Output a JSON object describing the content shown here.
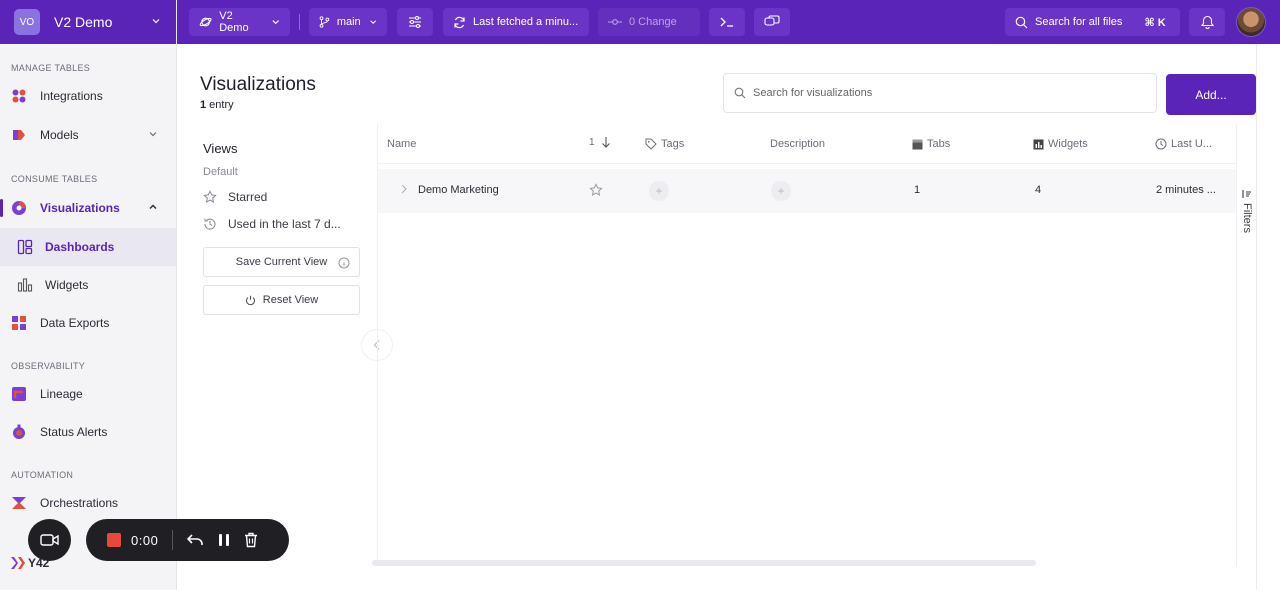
{
  "workspace": {
    "initials": "VO",
    "name": "V2 Demo"
  },
  "topbar": {
    "project": "V2 Demo",
    "branch": "main",
    "fetch_status": "Last fetched a minu...",
    "changes": "0 Change",
    "search_label": "Search for all files",
    "shortcut": "⌘ K"
  },
  "sidebar": {
    "sections": {
      "manage": "MANAGE TABLES",
      "consume": "CONSUME TABLES",
      "observability": "OBSERVABILITY",
      "automation": "AUTOMATION"
    },
    "items": {
      "integrations": "Integrations",
      "models": "Models",
      "visualizations": "Visualizations",
      "dashboards": "Dashboards",
      "widgets": "Widgets",
      "data_exports": "Data Exports",
      "lineage": "Lineage",
      "status_alerts": "Status Alerts",
      "orchestrations": "Orchestrations"
    },
    "brand": "Y42"
  },
  "page": {
    "title": "Visualizations",
    "entry_count": "1",
    "entry_label": " entry",
    "search_placeholder": "Search for visualizations",
    "add_label": "Add..."
  },
  "views": {
    "title": "Views",
    "default_label": "Default",
    "starred": "Starred",
    "recent": "Used in the last 7 d...",
    "save_btn": "Save Current View",
    "reset_btn": "Reset View"
  },
  "table": {
    "columns": {
      "name": "Name",
      "sort_count": "1",
      "tags": "Tags",
      "description": "Description",
      "tabs": "Tabs",
      "widgets": "Widgets",
      "last_updated": "Last U..."
    },
    "rows": [
      {
        "name": "Demo Marketing",
        "tabs": "1",
        "widgets": "4",
        "last_updated": "2 minutes ..."
      }
    ],
    "filters_label": "Filters"
  },
  "recorder": {
    "time": "0:00"
  },
  "colors": {
    "brand": "#5a24b8",
    "record": "#e64a3b"
  }
}
